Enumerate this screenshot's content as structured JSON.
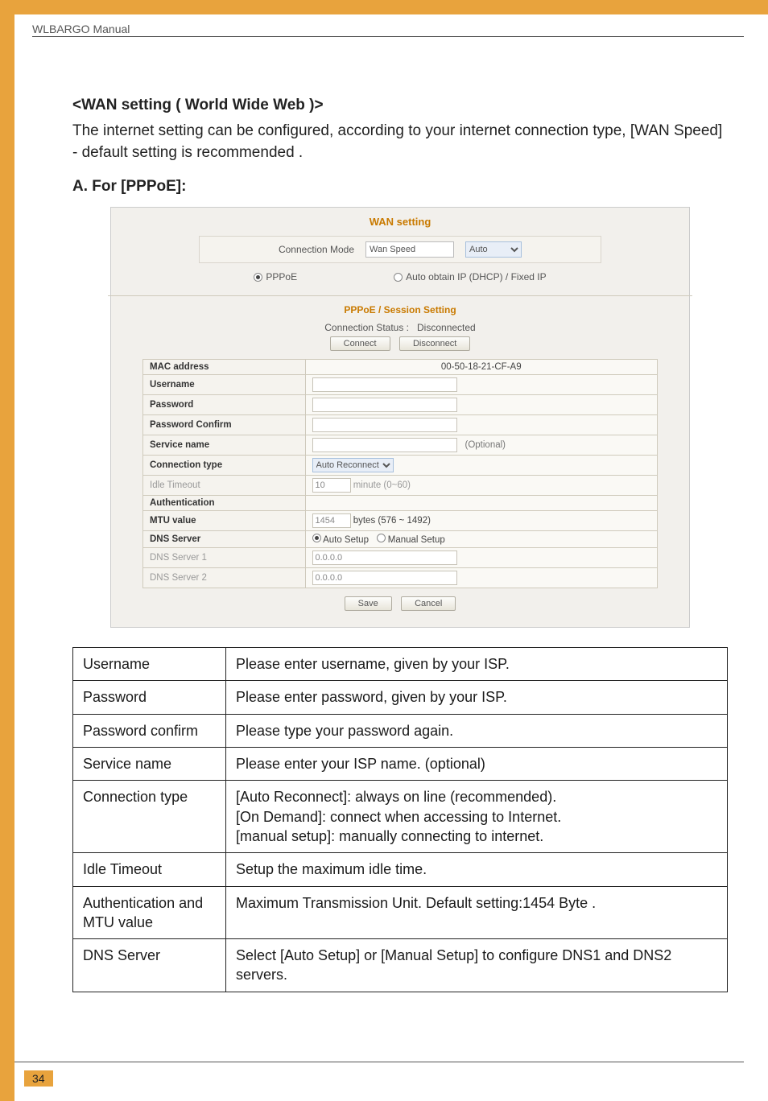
{
  "header": {
    "manual_label": "WLBARGO Manual"
  },
  "page": {
    "section_title": "<WAN setting ( World Wide Web )>",
    "intro": "The internet setting can be configured, according to your internet connection type, [WAN Speed] - default setting is recommended .",
    "subsection": "A. For [PPPoE]:",
    "number": "34"
  },
  "wan": {
    "title": "WAN setting",
    "conn_mode_label": "Connection Mode",
    "wan_speed_label": "Wan Speed",
    "auto_label": "Auto",
    "radio_pppoe": "PPPoE",
    "radio_dhcp": "Auto obtain IP (DHCP) / Fixed IP",
    "pppoe_section": "PPPoE / Session Setting",
    "status_label": "Connection Status :",
    "status_value": "Disconnected",
    "btn_connect": "Connect",
    "btn_disconnect": "Disconnect",
    "btn_save": "Save",
    "btn_cancel": "Cancel",
    "rows": {
      "mac_label": "MAC address",
      "mac_value": "00-50-18-21-CF-A9",
      "user_label": "Username",
      "pass_label": "Password",
      "passc_label": "Password Confirm",
      "svc_label": "Service name",
      "svc_note": "(Optional)",
      "ctype_label": "Connection type",
      "ctype_value": "Auto Reconnect",
      "idle_label": "Idle Timeout",
      "idle_value": "10",
      "idle_unit": "minute (0~60)",
      "auth_label": "Authentication",
      "mtu_label": "MTU value",
      "mtu_value": "1454",
      "mtu_unit": "bytes (576 ~ 1492)",
      "dns_label": "DNS Server",
      "dns_auto": "Auto Setup",
      "dns_manual": "Manual Setup",
      "dns1_label": "DNS Server 1",
      "dns1_value": "0.0.0.0",
      "dns2_label": "DNS Server 2",
      "dns2_value": "0.0.0.0"
    }
  },
  "desc": [
    {
      "k": "Username",
      "v": "Please enter username, given by your ISP."
    },
    {
      "k": "Password",
      "v": "Please enter password, given by your ISP."
    },
    {
      "k": "Password confirm",
      "v": "Please type your password again."
    },
    {
      "k": "Service name",
      "v": "Please enter your ISP name. (optional)"
    },
    {
      "k": "Connection type",
      "v": "[Auto Reconnect]:  always on line (recommended).\n[On Demand]: connect when accessing to Internet.\n[manual setup]: manually connecting to internet."
    },
    {
      "k": "Idle Timeout",
      "v": "Setup the maximum idle time."
    },
    {
      "k": "Authentication and MTU value",
      "v": "Maximum Transmission Unit. Default setting:1454 Byte ."
    },
    {
      "k": "DNS Server",
      "v": "Select [Auto Setup] or [Manual Setup] to configure DNS1 and DNS2 servers."
    }
  ]
}
